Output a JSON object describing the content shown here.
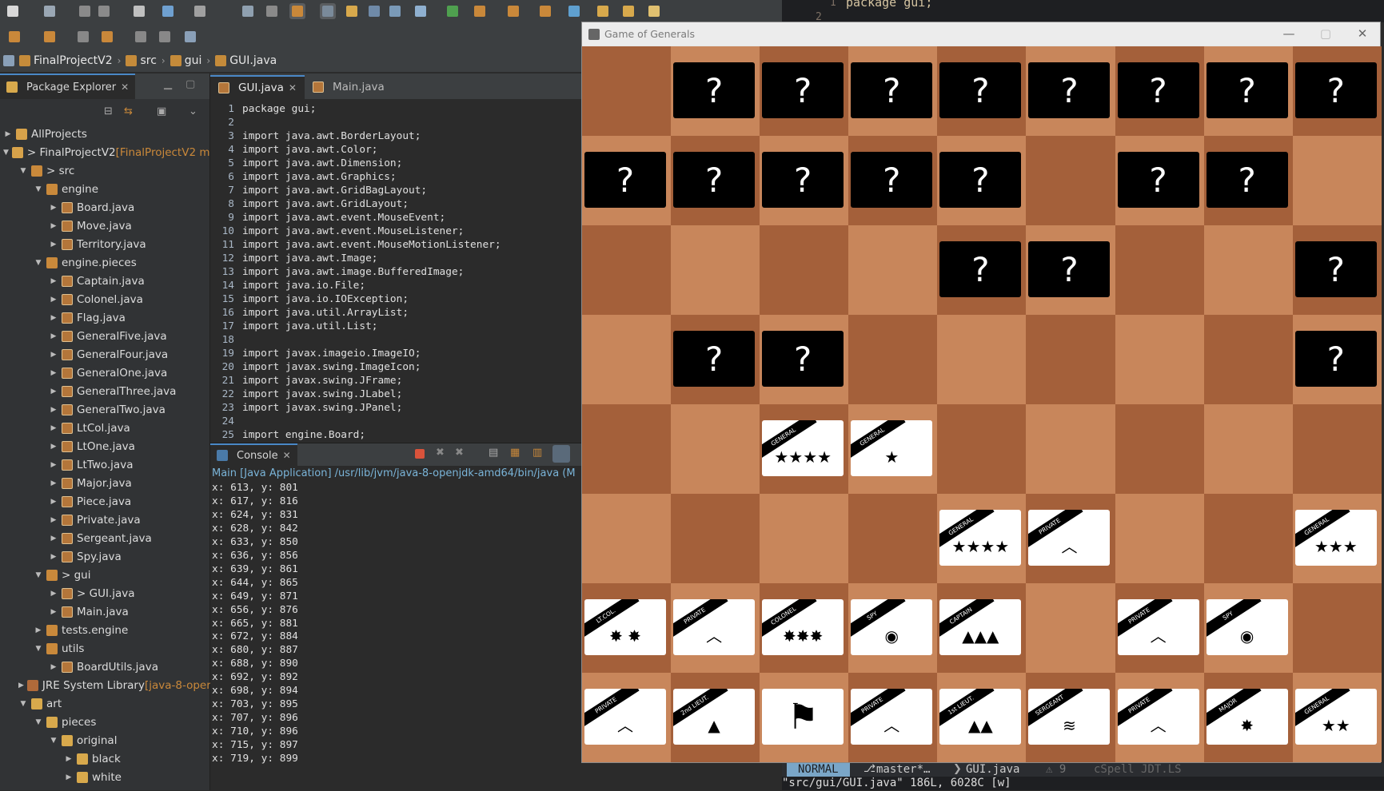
{
  "breadcrumb": [
    "FinalProjectV2",
    "src",
    "gui",
    "GUI.java"
  ],
  "package_explorer": {
    "title": "Package Explorer",
    "items": [
      {
        "label": "AllProjects",
        "depth": 0,
        "arrow": "▶",
        "icon": "project",
        "deco": ""
      },
      {
        "label": "> FinalProjectV2",
        "depth": 0,
        "arrow": "▼",
        "icon": "project",
        "deco": " [FinalProjectV2 m"
      },
      {
        "label": "> src",
        "depth": 1,
        "arrow": "▼",
        "icon": "pkg",
        "deco": ""
      },
      {
        "label": "engine",
        "depth": 2,
        "arrow": "▼",
        "icon": "pkg",
        "deco": ""
      },
      {
        "label": "Board.java",
        "depth": 3,
        "arrow": "▶",
        "icon": "java",
        "deco": ""
      },
      {
        "label": "Move.java",
        "depth": 3,
        "arrow": "▶",
        "icon": "java",
        "deco": ""
      },
      {
        "label": "Territory.java",
        "depth": 3,
        "arrow": "▶",
        "icon": "java",
        "deco": ""
      },
      {
        "label": "engine.pieces",
        "depth": 2,
        "arrow": "▼",
        "icon": "pkg",
        "deco": ""
      },
      {
        "label": "Captain.java",
        "depth": 3,
        "arrow": "▶",
        "icon": "java",
        "deco": ""
      },
      {
        "label": "Colonel.java",
        "depth": 3,
        "arrow": "▶",
        "icon": "java",
        "deco": ""
      },
      {
        "label": "Flag.java",
        "depth": 3,
        "arrow": "▶",
        "icon": "java",
        "deco": ""
      },
      {
        "label": "GeneralFive.java",
        "depth": 3,
        "arrow": "▶",
        "icon": "java",
        "deco": ""
      },
      {
        "label": "GeneralFour.java",
        "depth": 3,
        "arrow": "▶",
        "icon": "java",
        "deco": ""
      },
      {
        "label": "GeneralOne.java",
        "depth": 3,
        "arrow": "▶",
        "icon": "java",
        "deco": ""
      },
      {
        "label": "GeneralThree.java",
        "depth": 3,
        "arrow": "▶",
        "icon": "java",
        "deco": ""
      },
      {
        "label": "GeneralTwo.java",
        "depth": 3,
        "arrow": "▶",
        "icon": "java",
        "deco": ""
      },
      {
        "label": "LtCol.java",
        "depth": 3,
        "arrow": "▶",
        "icon": "java",
        "deco": ""
      },
      {
        "label": "LtOne.java",
        "depth": 3,
        "arrow": "▶",
        "icon": "java",
        "deco": ""
      },
      {
        "label": "LtTwo.java",
        "depth": 3,
        "arrow": "▶",
        "icon": "java",
        "deco": ""
      },
      {
        "label": "Major.java",
        "depth": 3,
        "arrow": "▶",
        "icon": "java",
        "deco": ""
      },
      {
        "label": "Piece.java",
        "depth": 3,
        "arrow": "▶",
        "icon": "java",
        "deco": ""
      },
      {
        "label": "Private.java",
        "depth": 3,
        "arrow": "▶",
        "icon": "java",
        "deco": ""
      },
      {
        "label": "Sergeant.java",
        "depth": 3,
        "arrow": "▶",
        "icon": "java",
        "deco": ""
      },
      {
        "label": "Spy.java",
        "depth": 3,
        "arrow": "▶",
        "icon": "java",
        "deco": ""
      },
      {
        "label": "> gui",
        "depth": 2,
        "arrow": "▼",
        "icon": "pkg",
        "deco": ""
      },
      {
        "label": "> GUI.java",
        "depth": 3,
        "arrow": "▶",
        "icon": "java",
        "deco": ""
      },
      {
        "label": "Main.java",
        "depth": 3,
        "arrow": "▶",
        "icon": "java",
        "deco": ""
      },
      {
        "label": "tests.engine",
        "depth": 2,
        "arrow": "▶",
        "icon": "pkg",
        "deco": ""
      },
      {
        "label": "utils",
        "depth": 2,
        "arrow": "▼",
        "icon": "pkg",
        "deco": ""
      },
      {
        "label": "BoardUtils.java",
        "depth": 3,
        "arrow": "▶",
        "icon": "java",
        "deco": ""
      },
      {
        "label": "JRE System Library",
        "depth": 1,
        "arrow": "▶",
        "icon": "lib",
        "deco": " [java-8-oper"
      },
      {
        "label": "art",
        "depth": 1,
        "arrow": "▼",
        "icon": "folder",
        "deco": ""
      },
      {
        "label": "pieces",
        "depth": 2,
        "arrow": "▼",
        "icon": "folder",
        "deco": ""
      },
      {
        "label": "original",
        "depth": 3,
        "arrow": "▼",
        "icon": "folder",
        "deco": ""
      },
      {
        "label": "black",
        "depth": 4,
        "arrow": "▶",
        "icon": "folder",
        "deco": ""
      },
      {
        "label": "white",
        "depth": 4,
        "arrow": "▶",
        "icon": "folder",
        "deco": ""
      }
    ]
  },
  "editor": {
    "tabs": [
      "GUI.java",
      "Main.java"
    ],
    "lines": [
      {
        "n": "1",
        "t": "package gui;"
      },
      {
        "n": "2",
        "t": ""
      },
      {
        "n": "3",
        "t": "import java.awt.BorderLayout;"
      },
      {
        "n": "4",
        "t": "import java.awt.Color;"
      },
      {
        "n": "5",
        "t": "import java.awt.Dimension;"
      },
      {
        "n": "6",
        "t": "import java.awt.Graphics;"
      },
      {
        "n": "7",
        "t": "import java.awt.GridBagLayout;"
      },
      {
        "n": "8",
        "t": "import java.awt.GridLayout;"
      },
      {
        "n": "9",
        "t": "import java.awt.event.MouseEvent;"
      },
      {
        "n": "10",
        "t": "import java.awt.event.MouseListener;"
      },
      {
        "n": "11",
        "t": "import java.awt.event.MouseMotionListener;"
      },
      {
        "n": "12",
        "t": "import java.awt.Image;"
      },
      {
        "n": "13",
        "t": "import java.awt.image.BufferedImage;"
      },
      {
        "n": "14",
        "t": "import java.io.File;"
      },
      {
        "n": "15",
        "t": "import java.io.IOException;"
      },
      {
        "n": "16",
        "t": "import java.util.ArrayList;"
      },
      {
        "n": "17",
        "t": "import java.util.List;"
      },
      {
        "n": "18",
        "t": ""
      },
      {
        "n": "19",
        "t": "import javax.imageio.ImageIO;"
      },
      {
        "n": "20",
        "t": "import javax.swing.ImageIcon;"
      },
      {
        "n": "21",
        "t": "import javax.swing.JFrame;"
      },
      {
        "n": "22",
        "t": "import javax.swing.JLabel;"
      },
      {
        "n": "23",
        "t": "import javax.swing.JPanel;"
      },
      {
        "n": "24",
        "t": ""
      },
      {
        "n": "25",
        "t": "import engine.Board;"
      }
    ]
  },
  "console": {
    "title": "Console",
    "info": "Main [Java Application] /usr/lib/jvm/java-8-openjdk-amd64/bin/java  (M",
    "lines": [
      "x: 613, y: 801",
      "x: 617, y: 816",
      "x: 624, y: 831",
      "x: 628, y: 842",
      "x: 633, y: 850",
      "x: 636, y: 856",
      "x: 639, y: 861",
      "x: 644, y: 865",
      "x: 649, y: 871",
      "x: 656, y: 876",
      "x: 665, y: 881",
      "x: 672, y: 884",
      "x: 680, y: 887",
      "x: 688, y: 890",
      "x: 692, y: 892",
      "x: 698, y: 894",
      "x: 703, y: 895",
      "x: 707, y: 896",
      "x: 710, y: 896",
      "x: 715, y: 897",
      "x: 719, y: 899"
    ]
  },
  "vim": {
    "top_lineno_1": "1",
    "top_text": "package gui;",
    "top_lineno_2": "2",
    "mode": "NORMAL",
    "branch": "master*…",
    "file": "GUI.java",
    "warnings": "⚠ 9",
    "plugins": "cSpell JDT.LS",
    "message": "\"src/gui/GUI.java\" 186L, 6028C [w]"
  },
  "game": {
    "title": "Game of Generals",
    "hidden_symbol": "?",
    "board": [
      [
        "",
        "?",
        "?",
        "?",
        "?",
        "?",
        "?",
        "?",
        "?"
      ],
      [
        "?",
        "?",
        "?",
        "?",
        "?",
        "",
        "?",
        "?",
        ""
      ],
      [
        "",
        "",
        "",
        "",
        "?",
        "?",
        "",
        "",
        "?"
      ],
      [
        "",
        "?",
        "?",
        "",
        "",
        "",
        "",
        "",
        "?"
      ],
      [
        "",
        "",
        "GENERAL|★★★★",
        "GENERAL|★",
        "",
        "",
        "",
        "",
        ""
      ],
      [
        "",
        "",
        "",
        "",
        "GENERAL|★★★★",
        "PRIVATE|︿",
        "",
        "",
        "GENERAL|★★★"
      ],
      [
        "LT.COL.|✸ ✸",
        "PRIVATE|︿",
        "COLONEL|✸✸✸",
        "SPY|◉",
        "CAPTAIN|▲▲▲",
        "",
        "PRIVATE|︿",
        "SPY|◉",
        ""
      ],
      [
        "PRIVATE|︿",
        "2nd LIEUT.|▲",
        "FLAG|⚑",
        "PRIVATE|︿",
        "1st LIEUT.|▲▲",
        "SERGEANT|≋",
        "PRIVATE|︿",
        "MAJOR|✸",
        "GENERAL|★★"
      ]
    ]
  }
}
